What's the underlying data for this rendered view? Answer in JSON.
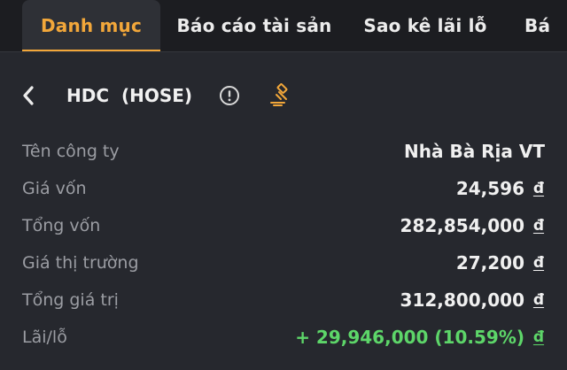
{
  "tabs": [
    {
      "label": "Danh mục",
      "active": true
    },
    {
      "label": "Báo cáo tài sản",
      "active": false
    },
    {
      "label": "Sao kê lãi lỗ",
      "active": false
    },
    {
      "label": "Bá",
      "active": false
    }
  ],
  "header": {
    "symbol": "HDC  (HOSE)",
    "icons": {
      "back": "chevron-left-icon",
      "info": "info-circle-icon",
      "auction": "gavel-icon"
    }
  },
  "details": [
    {
      "label": "Tên công ty",
      "value": "Nhà Bà Rịa VT",
      "currency": ""
    },
    {
      "label": "Giá vốn",
      "value": "24,596",
      "currency": "đ"
    },
    {
      "label": "Tổng vốn",
      "value": "282,854,000",
      "currency": "đ"
    },
    {
      "label": "Giá thị trường",
      "value": "27,200",
      "currency": "đ"
    },
    {
      "label": "Tổng giá trị",
      "value": "312,800,000",
      "currency": "đ"
    },
    {
      "label": "Lãi/lỗ",
      "value": "+ 29,946,000 (10.59%)",
      "currency": "đ"
    }
  ],
  "colors": {
    "accent": "#f2a73a",
    "positive": "#5dd669",
    "background": "#26282e",
    "tabbar": "#1c1d21",
    "label": "#9b9da3"
  }
}
